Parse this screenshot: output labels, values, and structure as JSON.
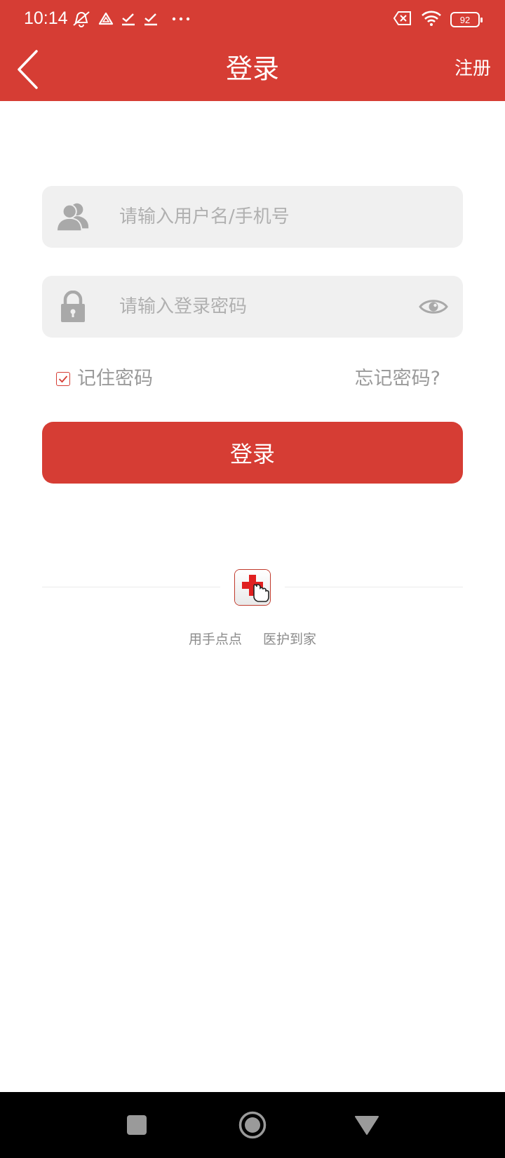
{
  "status_bar": {
    "time": "10:14",
    "battery": "92",
    "icons": [
      "mute-vibrate-icon",
      "drive-icon",
      "check-icon",
      "check-icon",
      "more-dots-icon",
      "sim-error-icon",
      "wifi-icon",
      "battery-icon"
    ]
  },
  "header": {
    "title": "登录",
    "register_label": "注册"
  },
  "form": {
    "username_placeholder": "请输入用户名/手机号",
    "password_placeholder": "请输入登录密码",
    "remember_label": "记住密码",
    "remember_checked": true,
    "forgot_label": "忘记密码?",
    "login_label": "登录"
  },
  "footer": {
    "slogan_left": "用手点点",
    "slogan_right": "医护到家"
  },
  "colors": {
    "brand": "#D63D34",
    "input_bg": "#F0F0F0",
    "muted_text": "#9A9A9A"
  }
}
